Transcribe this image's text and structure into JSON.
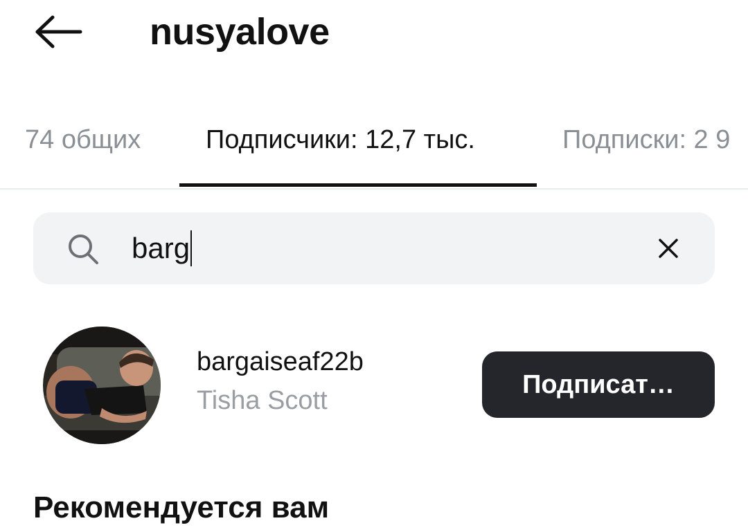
{
  "header": {
    "back_icon": "arrow-left-icon",
    "title": "nusyalove"
  },
  "tabs": [
    {
      "label": "74 общих",
      "active": false
    },
    {
      "label": "Подписчики: 12,7 тыс.",
      "active": true
    },
    {
      "label": "Подписки: 2 9",
      "active": false
    }
  ],
  "search": {
    "icon": "search-icon",
    "value": "barg",
    "clear_icon": "close-icon"
  },
  "results": [
    {
      "username": "bargaiseaf22b",
      "full_name": "Tisha Scott",
      "follow_label": "Подписат…"
    }
  ],
  "section": {
    "title": "Рекомендуется вам"
  },
  "colors": {
    "text": "#111111",
    "muted": "#8a8f95",
    "search_bg": "#f1f3f5",
    "button_bg": "#24262b",
    "button_text": "#ffffff"
  }
}
